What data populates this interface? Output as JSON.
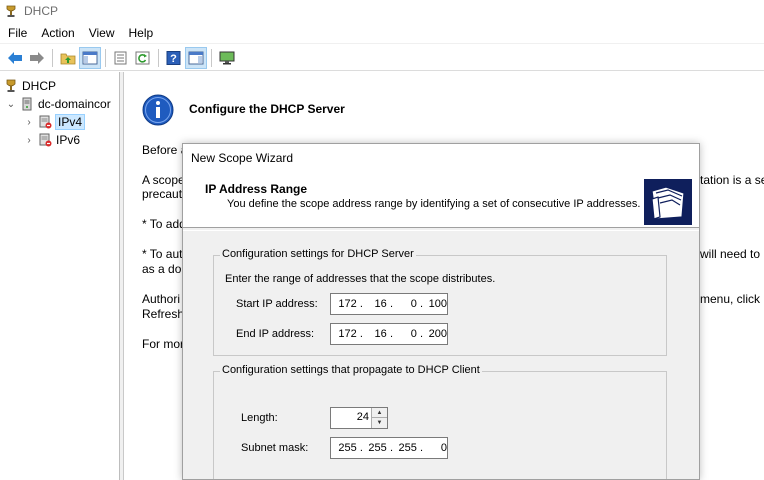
{
  "window": {
    "title": "DHCP"
  },
  "menu": [
    "File",
    "Action",
    "View",
    "Help"
  ],
  "toolbar": {
    "icons": [
      "back-arrow-icon",
      "forward-arrow-icon",
      "up-folder-icon",
      "show-hide-console-tree-icon",
      "properties-icon",
      "refresh-icon",
      "help-icon",
      "show-action-pane-icon",
      "monitor-icon"
    ]
  },
  "tree": {
    "root": "DHCP",
    "server": "dc-domaincor",
    "ipv4": "IPv4",
    "ipv6": "IPv6"
  },
  "content": {
    "heading": "Configure the DHCP Server",
    "lines_left": [
      "Before a",
      "A scope",
      "precaut",
      "* To add",
      "* To aut",
      "as a dor",
      "Authori",
      "Refresh.",
      "For mor"
    ],
    "lines_right": [
      "tation is a sec",
      "will need to",
      "menu, click"
    ]
  },
  "wizard": {
    "title": "New Scope Wizard",
    "header_title": "IP Address Range",
    "header_subtitle": "You define the scope address range by identifying a set of consecutive IP addresses.",
    "server_group": {
      "legend": "Configuration settings for DHCP Server",
      "instruction": "Enter the range of addresses that the scope distributes.",
      "start_label": "Start IP address:",
      "start_ip": [
        "172",
        "16",
        "0",
        "100"
      ],
      "end_label": "End IP address:",
      "end_ip": [
        "172",
        "16",
        "0",
        "200"
      ]
    },
    "client_group": {
      "legend": "Configuration settings that propagate to DHCP Client",
      "length_label": "Length:",
      "length_value": "24",
      "mask_label": "Subnet mask:",
      "mask": [
        "255",
        "255",
        "255",
        "0"
      ]
    }
  }
}
